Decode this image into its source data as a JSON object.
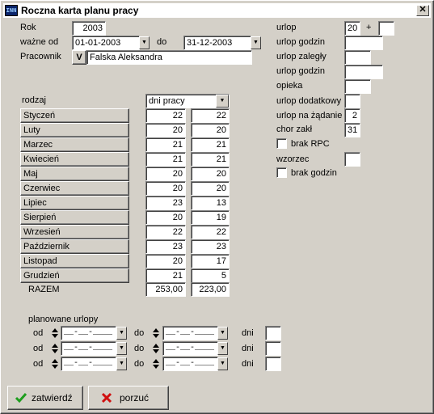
{
  "window": {
    "title": "Roczna karta planu pracy",
    "icon_text": "INN"
  },
  "header": {
    "rok_label": "Rok",
    "rok_value": "2003",
    "wazne_od_label": "ważne od",
    "wazne_od_value": "01-01-2003",
    "do_label": "do",
    "do_value": "31-12-2003",
    "pracownik_label": "Pracownik",
    "pracownik_button": "V",
    "pracownik_value": "Falska Aleksandra"
  },
  "right_panel": {
    "urlop_label": "urlop",
    "urlop_value": "20",
    "plus_label": "+",
    "urlop_extra": "",
    "urlop_godzin_label": "urlop godzin",
    "urlop_godzin_value": "",
    "urlop_zalegly_label": "urlop zaległy",
    "urlop_zalegly_value": "",
    "urlop_godzin2_label": "urlop godzin",
    "urlop_godzin2_value": "",
    "opieka_label": "opieka",
    "opieka_value": "",
    "urlop_dodatkowy_label": "urlop dodatkowy",
    "urlop_dodatkowy_value": "",
    "urlop_na_zadanie_label": "urlop na żądanie",
    "urlop_na_zadanie_value": "2",
    "chor_zakl_label": "chor zakł",
    "chor_zakl_value": "31",
    "brak_rpc_label": "brak RPC",
    "wzorzec_label": "wzorzec",
    "wzorzec_value": "",
    "brak_godzin_label": "brak godzin"
  },
  "table": {
    "rodzaj_label": "rodzaj",
    "rodzaj_value": "dni pracy",
    "months": [
      {
        "name": "Styczeń",
        "a": "22",
        "b": "22"
      },
      {
        "name": "Luty",
        "a": "20",
        "b": "20"
      },
      {
        "name": "Marzec",
        "a": "21",
        "b": "21"
      },
      {
        "name": "Kwiecień",
        "a": "21",
        "b": "21"
      },
      {
        "name": "Maj",
        "a": "20",
        "b": "20"
      },
      {
        "name": "Czerwiec",
        "a": "20",
        "b": "20"
      },
      {
        "name": "Lipiec",
        "a": "23",
        "b": "13"
      },
      {
        "name": "Sierpień",
        "a": "20",
        "b": "19"
      },
      {
        "name": "Wrzesień",
        "a": "22",
        "b": "22"
      },
      {
        "name": "Październik",
        "a": "23",
        "b": "23"
      },
      {
        "name": "Listopad",
        "a": "20",
        "b": "17"
      },
      {
        "name": "Grudzień",
        "a": "21",
        "b": "5"
      }
    ],
    "razem_label": "RAZEM",
    "razem_a": "253,00",
    "razem_b": "223,00"
  },
  "vacations": {
    "title": "planowane urlopy",
    "od_label": "od",
    "do_label": "do",
    "dni_label": "dni",
    "date_placeholder": "__-__-____",
    "rows": [
      {
        "dni": ""
      },
      {
        "dni": ""
      },
      {
        "dni": ""
      }
    ]
  },
  "footer": {
    "confirm_label": "zatwierdź",
    "cancel_label": "porzuć"
  },
  "colors": {
    "face": "#d4d0c8",
    "confirm_icon": "#1e9e1e",
    "cancel_icon": "#d01010"
  }
}
